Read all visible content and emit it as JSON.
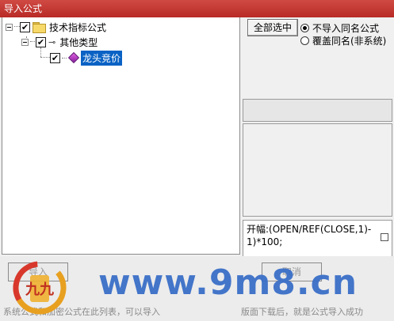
{
  "window": {
    "title": "导入公式"
  },
  "tree": {
    "root": {
      "label": "技术指标公式",
      "checked": true,
      "icon": "folder-icon"
    },
    "child": {
      "label": "其他类型",
      "checked": true,
      "icon": "key-icon"
    },
    "leaf": {
      "label": "龙头竞价",
      "checked": true,
      "icon": "gem-icon",
      "selected": true
    }
  },
  "options": {
    "select_all_label": "全部选中",
    "radio_skip_label": "不导入同名公式",
    "radio_overwrite_label": "覆盖同名(非系统)",
    "selected_radio": "skip"
  },
  "formula": {
    "text": "开幅:(OPEN/REF(CLOSE,1)-1)*100;"
  },
  "buttons": {
    "import_label": "导入",
    "cancel_label": "取消"
  },
  "status": {
    "left_text": "系统公式和加密公式在此列表，可以导入",
    "right_text": "版面下载后，就是公式导入成功"
  },
  "watermark": {
    "text": "www.9m8.cn",
    "logo_text": "九九"
  },
  "colors": {
    "titlebar": "#c0392b",
    "selection": "#0a62c4",
    "watermark": "#3a6fc8"
  }
}
